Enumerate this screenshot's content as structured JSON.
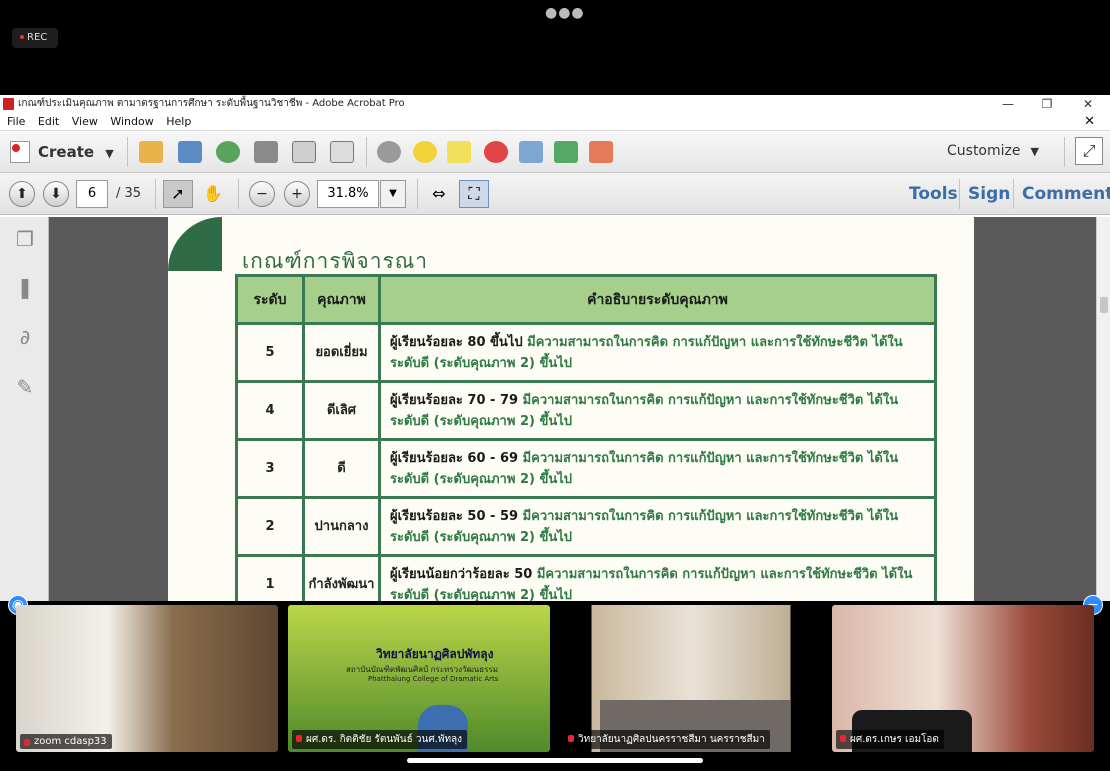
{
  "zoom": {
    "rec_label": "REC",
    "participants": [
      {
        "name": "zoom cdasp33"
      },
      {
        "name": "ผศ.ดร. กิตติชัย รัตนพันธ์ วนศ.พัทลุง"
      },
      {
        "name": "วิทยาลัยนาฏศิลปนครราชสีมา นครราชสีมา"
      },
      {
        "name": "ผศ.ดร.เกษร  เอมโอด"
      }
    ],
    "slide_header": "วิทยาลัยนาฏศิลปพัทลุง",
    "slide_sub": "สถาบันบัณฑิตพัฒนศิลป์ กระทรวงวัฒนธรรม",
    "slide_en": "Phatthalung College of Dramatic Arts"
  },
  "window": {
    "title": "เกณฑ์ประเมินคุณภาพ ตามาตรฐานการศึกษา ระดับพื้นฐานวิชาชีพ - Adobe Acrobat Pro",
    "minimize": "—",
    "restore": "❐",
    "close": "✕"
  },
  "menu": [
    "File",
    "Edit",
    "View",
    "Window",
    "Help"
  ],
  "toolbar": {
    "create_label": "Create",
    "customize_label": "Customize"
  },
  "nav": {
    "page": "6",
    "total": "/ 35",
    "zoom": "31.8%",
    "tools": "Tools",
    "sign": "Sign",
    "comment": "Comment"
  },
  "doc": {
    "title": "เกณฑ์การพิจารณา",
    "headers": {
      "level": "ระดับ",
      "quality": "คุณภาพ",
      "desc": "คำอธิบายระดับคุณภาพ"
    },
    "rows": [
      {
        "level": "5",
        "quality": "ยอดเยี่ยม",
        "desc_bold": "ผู้เรียนร้อยละ 80 ขึ้นไป",
        "desc_green": " มีความสามารถในการคิด การแก้ปัญหา และการใช้ทักษะชีวิต ได้ในระดับดี (ระดับคุณภาพ 2) ขึ้นไป"
      },
      {
        "level": "4",
        "quality": "ดีเลิศ",
        "desc_bold": "ผู้เรียนร้อยละ 70 - 79",
        "desc_green": " มีความสามารถในการคิด การแก้ปัญหา และการใช้ทักษะชีวิต ได้ในระดับดี (ระดับคุณภาพ 2) ขึ้นไป"
      },
      {
        "level": "3",
        "quality": "ดี",
        "desc_bold": "ผู้เรียนร้อยละ 60 - 69",
        "desc_green": " มีความสามารถในการคิด การแก้ปัญหา และการใช้ทักษะชีวิต ได้ในระดับดี (ระดับคุณภาพ 2) ขึ้นไป"
      },
      {
        "level": "2",
        "quality": "ปานกลาง",
        "desc_bold": "ผู้เรียนร้อยละ 50 - 59",
        "desc_green": " มีความสามารถในการคิด การแก้ปัญหา และการใช้ทักษะชีวิต ได้ในระดับดี (ระดับคุณภาพ 2) ขึ้นไป"
      },
      {
        "level": "1",
        "quality": "กำลังพัฒนา",
        "desc_bold": "ผู้เรียนน้อยกว่าร้อยละ 50",
        "desc_green": " มีความสามารถในการคิด การแก้ปัญหา และการใช้ทักษะชีวิต ได้ในระดับดี (ระดับคุณภาพ 2) ขึ้นไป"
      }
    ]
  },
  "colors": {
    "accent_green": "#2f6b45",
    "header_green": "#a7cf8c",
    "link_blue": "#3b6ea5"
  }
}
